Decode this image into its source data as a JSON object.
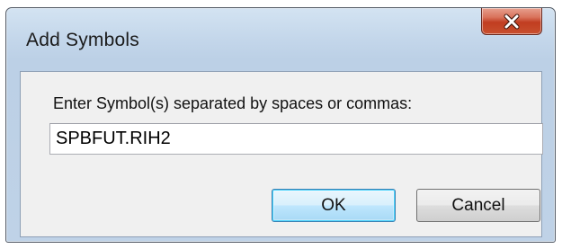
{
  "window": {
    "title": "Add Symbols",
    "close_icon": "close-icon",
    "close_color": "#c13d20"
  },
  "form": {
    "prompt_label": "Enter Symbol(s) separated by spaces or commas:",
    "symbol_value": "SPBFUT.RIH2",
    "symbol_placeholder": ""
  },
  "buttons": {
    "ok_label": "OK",
    "cancel_label": "Cancel"
  }
}
